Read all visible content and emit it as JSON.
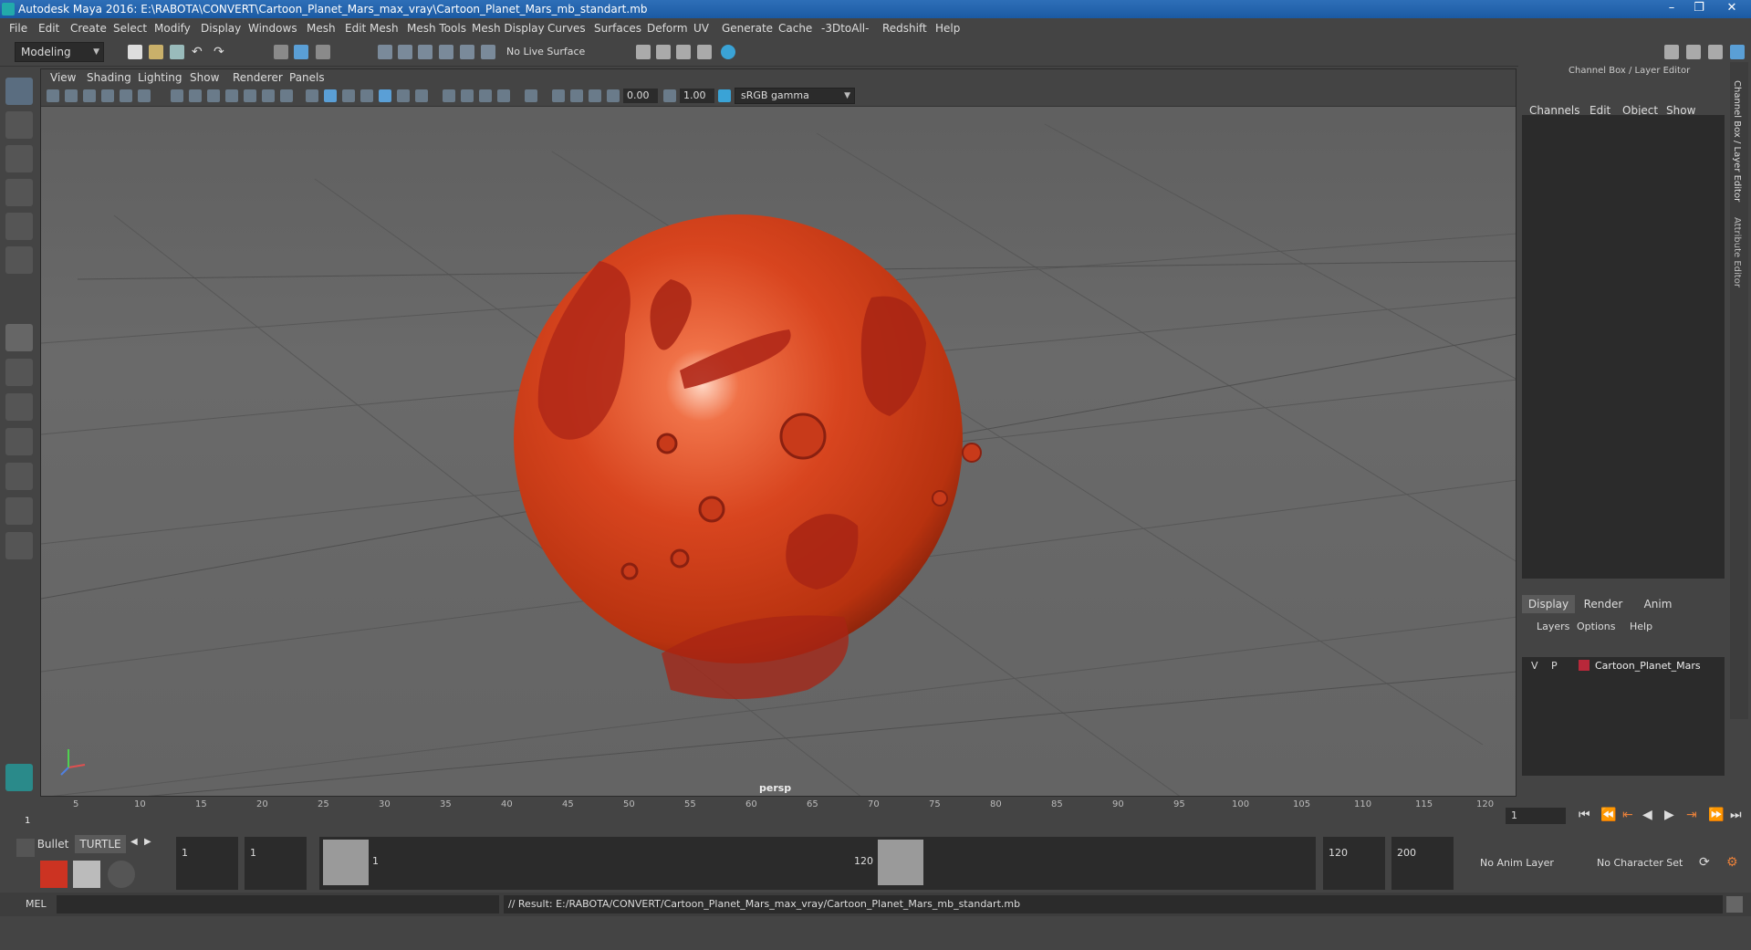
{
  "window": {
    "title": "Autodesk Maya 2016: E:\\RABOTA\\CONVERT\\Cartoon_Planet_Mars_max_vray\\Cartoon_Planet_Mars_mb_standart.mb",
    "minimize": "–",
    "restore": "❐",
    "close": "✕"
  },
  "menubar": [
    "File",
    "Edit",
    "Create",
    "Select",
    "Modify",
    "Display",
    "Windows",
    "Mesh",
    "Edit Mesh",
    "Mesh Tools",
    "Mesh Display",
    "Curves",
    "Surfaces",
    "Deform",
    "UV",
    "Generate",
    "Cache",
    "-3DtoAll-",
    "Redshift",
    "Help"
  ],
  "toolbar": {
    "mode": "Modeling",
    "live_surface": "No Live Surface"
  },
  "viewport": {
    "menu": [
      "View",
      "Shading",
      "Lighting",
      "Show",
      "Renderer",
      "Panels"
    ],
    "exposure": "0.00",
    "gamma": "1.00",
    "color_space": "sRGB gamma",
    "camera_label": "persp"
  },
  "right_panel": {
    "header": "Channel Box / Layer Editor",
    "channel_menu": [
      "Channels",
      "Edit",
      "Object",
      "Show"
    ],
    "side_tabs": [
      "Channel Box / Layer Editor",
      "Attribute Editor"
    ],
    "layer_tabs": [
      "Display",
      "Render",
      "Anim"
    ],
    "layer_menu": [
      "Layers",
      "Options",
      "Help"
    ],
    "layer": {
      "v": "V",
      "p": "P",
      "name": "Cartoon_Planet_Mars",
      "color": "#b8283a"
    }
  },
  "timeline": {
    "ticks": [
      "5",
      "10",
      "15",
      "20",
      "25",
      "30",
      "35",
      "40",
      "45",
      "50",
      "55",
      "60",
      "65",
      "70",
      "75",
      "80",
      "85",
      "90",
      "95",
      "100",
      "105",
      "110",
      "115",
      "120"
    ],
    "start_marker": "1",
    "current_frame": "1"
  },
  "range": {
    "shelf_tabs": [
      "Bullet",
      "TURTLE"
    ],
    "start": "1",
    "playback_start": "1",
    "slider_start": "1",
    "slider_end": "120",
    "playback_end": "120",
    "end": "200",
    "anim_layer": "No Anim Layer",
    "character_set": "No Character Set"
  },
  "command": {
    "label": "MEL",
    "result": "// Result: E:/RABOTA/CONVERT/Cartoon_Planet_Mars_max_vray/Cartoon_Planet_Mars_mb_standart.mb"
  },
  "colors": {
    "planet": "#d8451f",
    "titlebar": "#1b5aa3",
    "accent": "#5a9fd6"
  }
}
